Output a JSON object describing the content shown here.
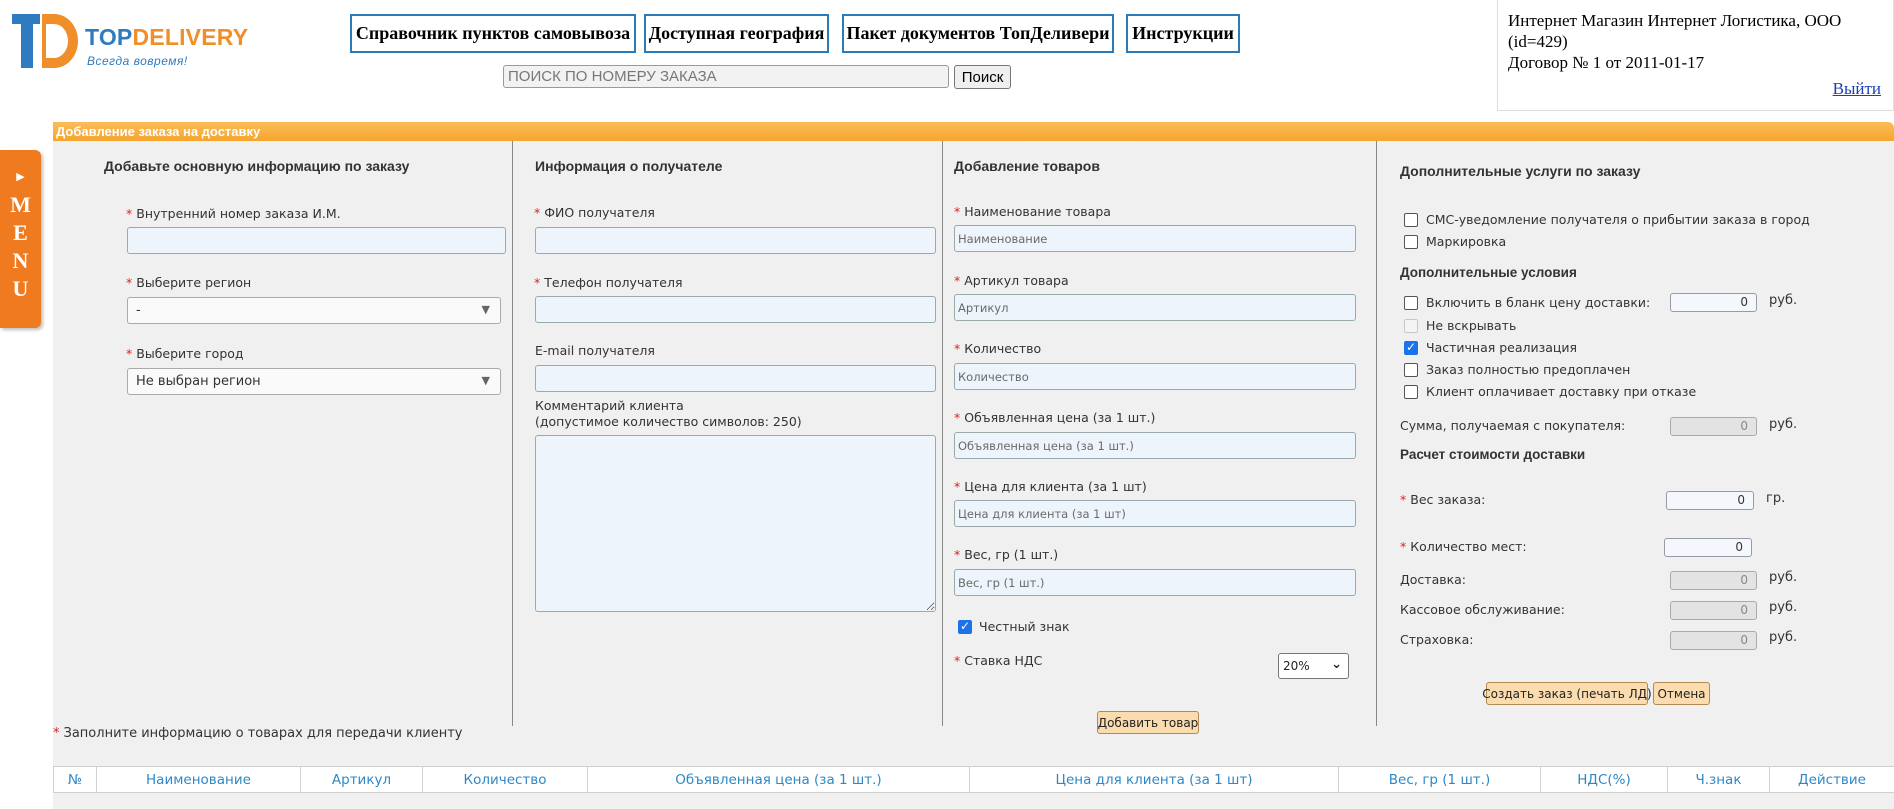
{
  "logo": {
    "name_part1": "TOP",
    "name_part2": "DELIVERY",
    "tagline": "Всегда вовремя!"
  },
  "nav": [
    {
      "label": "Справочник пунктов самовывоза"
    },
    {
      "label": "Доступная география"
    },
    {
      "label": "Пакет документов ТопДеливери"
    },
    {
      "label": "Инструкции"
    }
  ],
  "search": {
    "placeholder": "ПОИСК ПО НОМЕРУ ЗАКАЗА",
    "button": "Поиск"
  },
  "account": {
    "line1": "Интернет Магазин Интернет Логистика, ООО",
    "line2": "(id=429)",
    "line3": "Договор № 1 от 2011-01-17",
    "logout": "Выйти"
  },
  "side_menu": {
    "arrow": "▶",
    "letters": [
      "M",
      "E",
      "N",
      "U"
    ]
  },
  "panel": {
    "title": "Добавление заказа на доставку"
  },
  "col1": {
    "title": "Добавьте основную информацию по заказу",
    "order_number_label": "Внутренний номер заказа И.М.",
    "region_label": "Выберите регион",
    "region_value": "-",
    "city_label": "Выберите город",
    "city_value": "Не выбран регион"
  },
  "col2": {
    "title": "Информация о получателе",
    "fio_label": "ФИО получателя",
    "phone_label": "Телефон получателя",
    "email_label": "E-mail получателя",
    "comment_label1": "Комментарий клиента",
    "comment_label2": "(допустимое количество символов: 250)"
  },
  "col3": {
    "title": "Добавление товаров",
    "name_label": "Наименование товара",
    "name_placeholder": "Наименование",
    "sku_label": "Артикул товара",
    "sku_placeholder": "Артикул",
    "qty_label": "Количество",
    "qty_placeholder": "Количество",
    "declared_label": "Объявленная цена (за 1 шт.)",
    "declared_placeholder": "Объявленная цена (за 1 шт.)",
    "client_price_label": "Цена для клиента (за 1 шт)",
    "client_price_placeholder": "Цена для клиента (за 1 шт)",
    "weight_label": "Вес, гр (1 шт.)",
    "weight_placeholder": "Вес, гр (1 шт.)",
    "honest_sign_label": "Честный знак",
    "honest_sign_checked": true,
    "vat_label": "Ставка НДС",
    "vat_value": "20%",
    "add_button": "Добавить товар"
  },
  "col4": {
    "title": "Дополнительные услуги по заказу",
    "sms_label": "СМС-уведомление получателя о прибытии заказа в город",
    "marking_label": "Маркировка",
    "conditions_title": "Дополнительные условия",
    "include_price_label": "Включить в бланк цену доставки:",
    "include_price_value": "0",
    "unit_rub": "руб.",
    "unit_gr": "гр.",
    "no_open_label": "Не вскрывать",
    "partial_label": "Частичная реализация",
    "partial_checked": true,
    "prepaid_label": "Заказ полностью предоплачен",
    "client_pays_label": "Клиент оплачивает доставку при отказе",
    "sum_label": "Сумма, получаемая с покупателя:",
    "sum_value": "0",
    "calc_title": "Расчет стоимости доставки",
    "weight_label": "Вес заказа:",
    "weight_value": "0",
    "places_label": "Количество мест:",
    "places_value": "0",
    "delivery_label": "Доставка:",
    "delivery_value": "0",
    "cash_label": "Кассовое обслуживание:",
    "cash_value": "0",
    "insurance_label": "Страховка:",
    "insurance_value": "0",
    "create_button": "Создать заказ (печать ЛД)",
    "cancel_button": "Отмена"
  },
  "goods_note": "Заполните информацию о товарах для передачи клиенту",
  "table_headers": [
    "№",
    "Наименование",
    "Артикул",
    "Количество",
    "Объявленная цена (за 1 шт.)",
    "Цена для клиента (за 1 шт)",
    "Вес, гр (1 шт.)",
    "НДС(%)",
    "Ч.знак",
    "Действие"
  ],
  "colors": {
    "brand_blue": "#2f7bbf",
    "brand_orange": "#f08f2a",
    "panel_orange": "#f6a52e",
    "link_blue": "#2f88c6"
  }
}
